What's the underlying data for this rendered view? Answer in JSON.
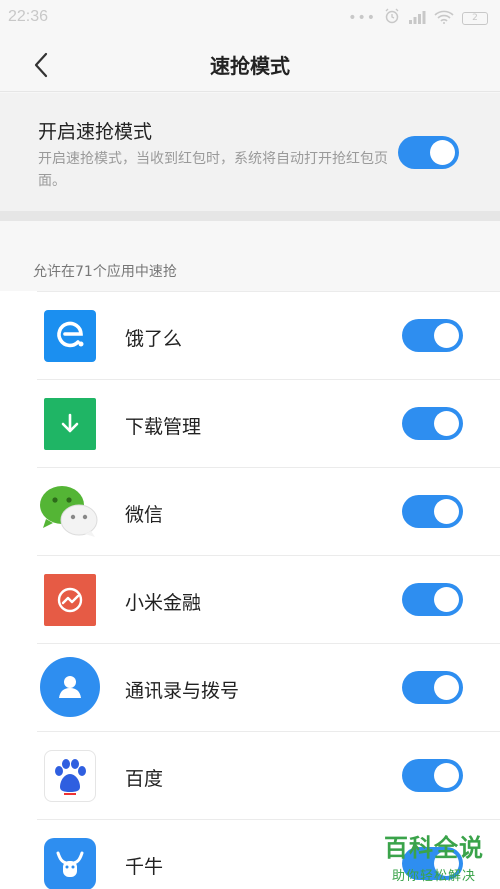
{
  "status_bar": {
    "time": "22:36",
    "dots": "•••",
    "battery": "2"
  },
  "nav": {
    "title": "速抢模式"
  },
  "main": {
    "title": "开启速抢模式",
    "description": "开启速抢模式，当收到红包时，系统将自动打开抢红包页面。",
    "enabled": true
  },
  "section_label": "允许在71个应用中速抢",
  "apps": [
    {
      "name": "饿了么",
      "icon": "eleme-icon",
      "color": "#1b8ff0",
      "enabled": true
    },
    {
      "name": "下载管理",
      "icon": "download-icon",
      "color": "#1fb565",
      "enabled": true
    },
    {
      "name": "微信",
      "icon": "wechat-icon",
      "color": "#54b535",
      "enabled": true
    },
    {
      "name": "小米金融",
      "icon": "mi-finance-icon",
      "color": "#e65b45",
      "enabled": true
    },
    {
      "name": "通讯录与拨号",
      "icon": "contacts-icon",
      "color": "#2e8ef0",
      "enabled": true
    },
    {
      "name": "百度",
      "icon": "baidu-icon",
      "color": "#2f5fe0",
      "enabled": true
    },
    {
      "name": "千牛",
      "icon": "qianniu-icon",
      "color": "#2e8ef0",
      "enabled": true
    }
  ],
  "watermark": {
    "title": "百科全说",
    "subtitle": "助你轻松解决"
  },
  "colors": {
    "accent": "#2e8ef0",
    "background": "#f7f7f7",
    "watermark": "#3aa34a"
  }
}
